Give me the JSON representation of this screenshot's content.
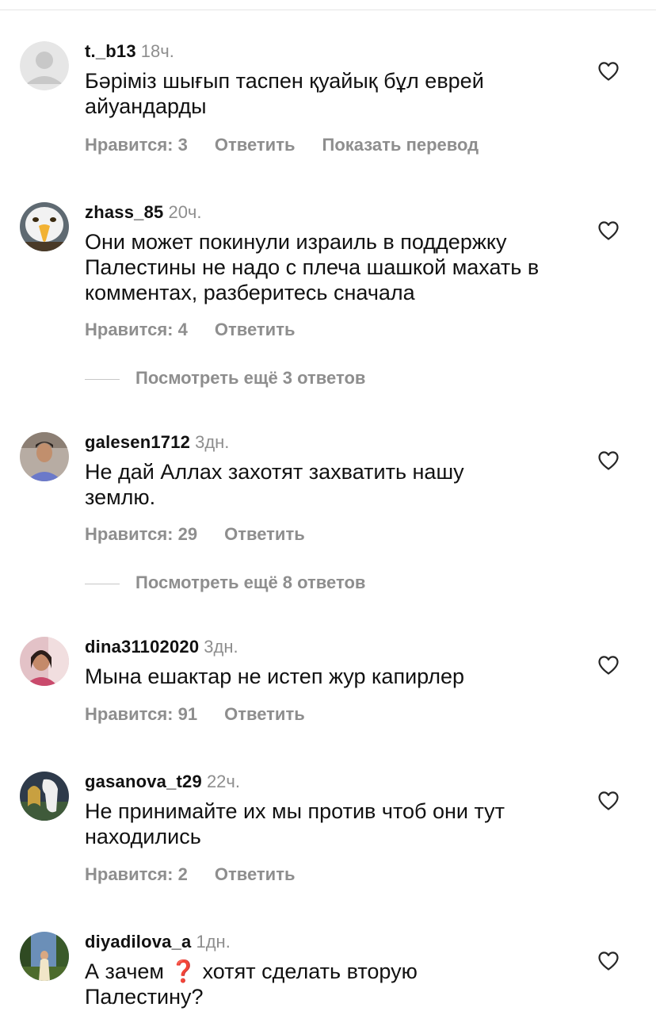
{
  "comments": [
    {
      "username": "t._b13",
      "time": "18ч.",
      "text": "Бәріміз шығып таспен қуайық бұл еврей айуандарды",
      "likes": "Нравится: 3",
      "reply": "Ответить",
      "translate": "Показать перевод",
      "avatar": "default-avatar"
    },
    {
      "username": "zhass_85",
      "time": "20ч.",
      "text": "Они может покинули израиль в поддержку Палестины не надо с плеча шашкой махать в комментах, разберитесь сначала",
      "likes": "Нравится: 4",
      "reply": "Ответить",
      "view_replies": "Посмотреть ещё 3 ответов",
      "avatar": "eagle-avatar"
    },
    {
      "username": "galesen1712",
      "time": "3дн.",
      "text": "Не дай Аллах захотят захватить нашу землю.",
      "likes": "Нравится: 29",
      "reply": "Ответить",
      "view_replies": "Посмотреть ещё 8 ответов",
      "avatar": "user-photo-avatar"
    },
    {
      "username": "dina31102020",
      "time": "3дн.",
      "text": "Мына ешактар не истеп жур капирлер",
      "likes": "Нравится: 91",
      "reply": "Ответить",
      "avatar": "user-photo-avatar"
    },
    {
      "username": "gasanova_t29",
      "time": "22ч.",
      "text": "Не принимайте их мы против чтоб они тут находились",
      "likes": "Нравится: 2",
      "reply": "Ответить",
      "avatar": "horse-avatar"
    },
    {
      "username": "diyadilova_a",
      "time": "1дн.",
      "text_before": "А зачем",
      "text_emoji": "❓",
      "text_after": " хотят сделать вторую Палестину?",
      "avatar": "outdoor-photo-avatar"
    }
  ],
  "icons": {
    "like": "heart-outline-icon",
    "emoji": "red-question-mark"
  },
  "colors": {
    "text": "#111111",
    "secondary": "#8e8e8e",
    "emoji_red": "#e0242c"
  }
}
